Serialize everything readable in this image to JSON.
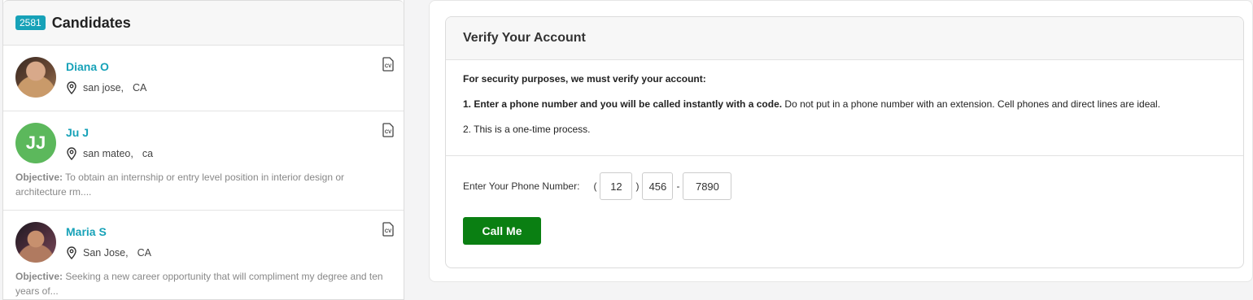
{
  "candidates_panel": {
    "count": "2581",
    "title": "Candidates",
    "items": [
      {
        "name": "Diana O",
        "city": "san jose,",
        "state": "CA",
        "avatar": "photo",
        "objective_label": "",
        "objective": ""
      },
      {
        "name": "Ju J",
        "city": "san mateo,",
        "state": "ca",
        "avatar": "initials",
        "initials": "JJ",
        "objective_label": "Objective:",
        "objective": "To obtain an internship or entry level position in interior design or architecture rm...."
      },
      {
        "name": "Maria S",
        "city": "San Jose,",
        "state": "CA",
        "avatar": "photo",
        "objective_label": "Objective:",
        "objective": "Seeking a new career opportunity that will compliment my degree and ten years of..."
      }
    ]
  },
  "verify": {
    "title": "Verify Your Account",
    "intro": "For security purposes, we must verify your account:",
    "step1_bold": "1. Enter a phone number and you will be called instantly with a code.",
    "step1_rest": " Do not put in a phone number with an extension. Cell phones and direct lines are ideal.",
    "step2": "2. This is a one-time process.",
    "phone_label": "Enter Your Phone Number:",
    "open_paren": "(",
    "close_paren": ")",
    "dash": "-",
    "area_code": "12",
    "prefix": "456",
    "line_number": "7890",
    "call_button": "Call Me"
  },
  "colors": {
    "accent": "#17a2b8",
    "call_button": "#0a7f12",
    "initials_avatar": "#5cb85c"
  },
  "icons": [
    "location-pin-icon",
    "cv-document-icon"
  ]
}
